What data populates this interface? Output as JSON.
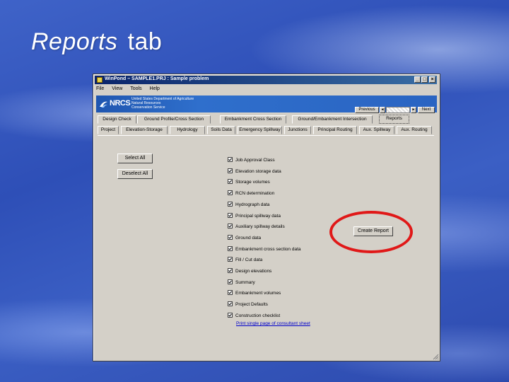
{
  "slide": {
    "title_italic": "Reports",
    "title_rest": "tab"
  },
  "window": {
    "title": "WinPond – SAMPLE1.PRJ : Sample problem",
    "min_glyph": "_",
    "max_glyph": "□",
    "close_glyph": "×"
  },
  "menu": [
    "File",
    "View",
    "Tools",
    "Help"
  ],
  "banner": {
    "logo_text": "NRCS",
    "agency_lines": [
      "United States Department of Agriculture",
      "Natural Resources",
      "Conservation Service"
    ],
    "previous_label": "Previous",
    "next_label": "Next",
    "left_arrow": "◄",
    "right_arrow": "►"
  },
  "tabs_row1": [
    "Design Check",
    "Ground Profile/Cross Section",
    "Embankment Cross Section",
    "Ground/Embankment Intersection",
    "Reports"
  ],
  "tabs_row2": [
    "Project",
    "Elevation-Storage",
    "Hydrology",
    "Soils Data",
    "Emergency Spillway",
    "Junctions",
    "Principal Routing",
    "Aux. Spillway",
    "Aux. Routing"
  ],
  "buttons": {
    "select_all": "Select All",
    "deselect_all": "Deselect All",
    "create_report": "Create Report"
  },
  "report_items": [
    {
      "label": "Job Approval Class",
      "checked": true
    },
    {
      "label": "Elevation storage data",
      "checked": true
    },
    {
      "label": "Storage volumes",
      "checked": true
    },
    {
      "label": "RCN determination",
      "checked": true
    },
    {
      "label": "Hydrograph data",
      "checked": true
    },
    {
      "label": "Principal spillway data",
      "checked": true
    },
    {
      "label": "Auxiliary spillway details",
      "checked": true
    },
    {
      "label": "Ground data",
      "checked": true
    },
    {
      "label": "Embankment cross section data",
      "checked": true
    },
    {
      "label": "Fill / Cut data",
      "checked": true
    },
    {
      "label": "Design elevations",
      "checked": true
    },
    {
      "label": "Summary",
      "checked": true
    },
    {
      "label": "Embankment volumes",
      "checked": true
    },
    {
      "label": "Project Defaults",
      "checked": true
    },
    {
      "label": "Construction checklist",
      "checked": true
    }
  ],
  "link_text": "Print single page of consultant sheet",
  "colors": {
    "highlight": "#e01818",
    "titlebar": "#0a246a",
    "banner": "#2a64c2"
  }
}
